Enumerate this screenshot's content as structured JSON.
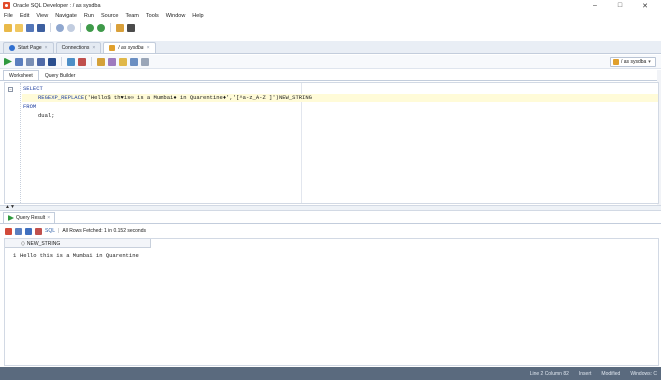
{
  "window": {
    "title": "Oracle SQL Developer : / as sysdba",
    "minimize": "–",
    "maximize": "□",
    "close": "✕"
  },
  "menu": [
    "File",
    "Edit",
    "View",
    "Navigate",
    "Run",
    "Source",
    "Team",
    "Tools",
    "Window",
    "Help"
  ],
  "doc_tabs": [
    {
      "label": "Start Page",
      "icon": "help-icon"
    },
    {
      "label": "Connections",
      "icon": "none"
    },
    {
      "label": "/ as sysdba",
      "icon": "connection-icon",
      "active": true
    }
  ],
  "connection": {
    "selected": "/ as sysdba"
  },
  "editor_tabs": [
    "Worksheet",
    "Query Builder"
  ],
  "editor": {
    "line1": "SELECT",
    "line2_func": "REGEXP_REPLACE",
    "line2_args": "('Hello$ th♥is∞ is a Mumbai● in Quarentine♦','[^a-z_A-Z ]')",
    "line2_alias": "NEW_STRING",
    "line3": "FROM",
    "line4": "dual;"
  },
  "results": {
    "tab_label": "Query Result",
    "sql_label": "SQL",
    "status": "All Rows Fetched: 1 in 0.152 seconds",
    "column": "NEW_STRING",
    "row_number": "1",
    "row_value": "Hello this is a Mumbai in Quarentine"
  },
  "status_bar": {
    "position": "Line 2 Column 82",
    "mode": "Insert",
    "state": "Modified",
    "os": "Windows: C"
  },
  "colors": {
    "status_bg": "#5a6a7e",
    "keyword": "#1f3f9f",
    "line_highlight": "#fffbd8"
  }
}
